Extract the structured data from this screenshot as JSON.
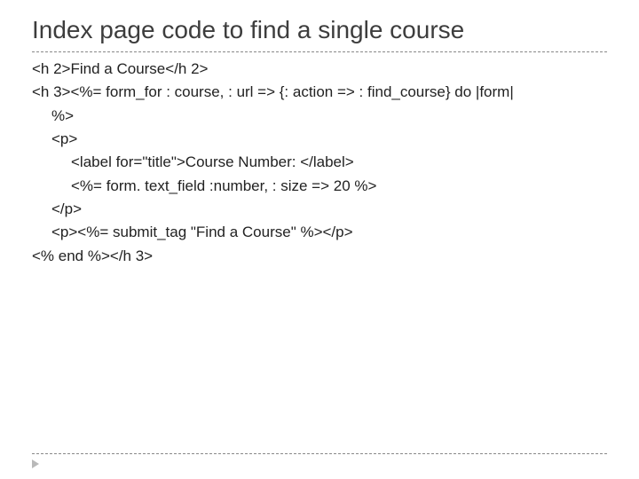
{
  "title": "Index page code to find a single course",
  "code": {
    "l1": "<h 2>Find a Course</h 2>",
    "l2a": "<h 3><%= form_for : course, : url => {: action => : find_course} do |form|",
    "l2b": "%>",
    "l3": "<p>",
    "l4": "<label for=\"title\">Course Number: </label>",
    "l5": "<%= form. text_field :number, : size => 20 %>",
    "l6": "</p>",
    "l7": "<p><%= submit_tag  \"Find a Course\" %></p>",
    "l8": "<% end %></h 3>"
  }
}
